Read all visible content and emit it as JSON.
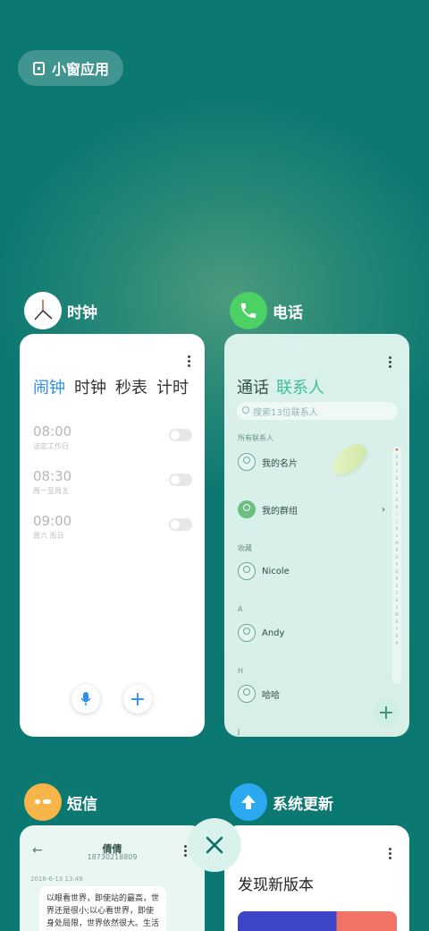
{
  "floating_window_button": {
    "label": "小窗应用"
  },
  "cards": {
    "clock": {
      "app_name": "时钟",
      "tabs": [
        "闹钟",
        "时钟",
        "秒表",
        "计时"
      ],
      "alarms": [
        {
          "time": "08:00",
          "repeat": "法定工作日"
        },
        {
          "time": "08:30",
          "repeat": "周一至周五"
        },
        {
          "time": "09:00",
          "repeat": "周六 周日"
        }
      ]
    },
    "phone": {
      "app_name": "电话",
      "tabs": [
        "通话",
        "联系人"
      ],
      "search_placeholder": "搜索13位联系人",
      "all_contacts_label": "所有联系人",
      "my_card": "我的名片",
      "my_groups": "我的群组",
      "section_favorites": "收藏",
      "section_a": "A",
      "section_h": "H",
      "section_j": "J",
      "contacts": [
        "Nicole",
        "Andy",
        "哈哈"
      ],
      "alphabet": [
        "♥",
        "A",
        "B",
        "C",
        "D",
        "E",
        "F",
        "G",
        "H",
        "I",
        "J",
        "K",
        "L",
        "M",
        "N",
        "O",
        "P",
        "Q",
        "R",
        "S",
        "T",
        "U",
        "V",
        "W",
        "X",
        "Y",
        "Z",
        "#"
      ]
    },
    "messages": {
      "app_name": "短信",
      "contact_name": "倩倩",
      "contact_number": "18730218809",
      "timestamp": "2016-6-13 13:49",
      "message_text": "以眼看世界，即使站的最高，世界还是很小;以心看世界，即使身处局限，世界依然很大。生活远不完"
    },
    "update": {
      "app_name": "系统更新",
      "heading": "发现新版本"
    }
  },
  "colors": {
    "background": "#0c7872",
    "clock_accent": "#2d8ff0",
    "phone_accent": "#3fbf9c",
    "phone_icon": "#4cd164",
    "sms_icon": "#f7b54a",
    "update_icon": "#2aa8f0"
  }
}
